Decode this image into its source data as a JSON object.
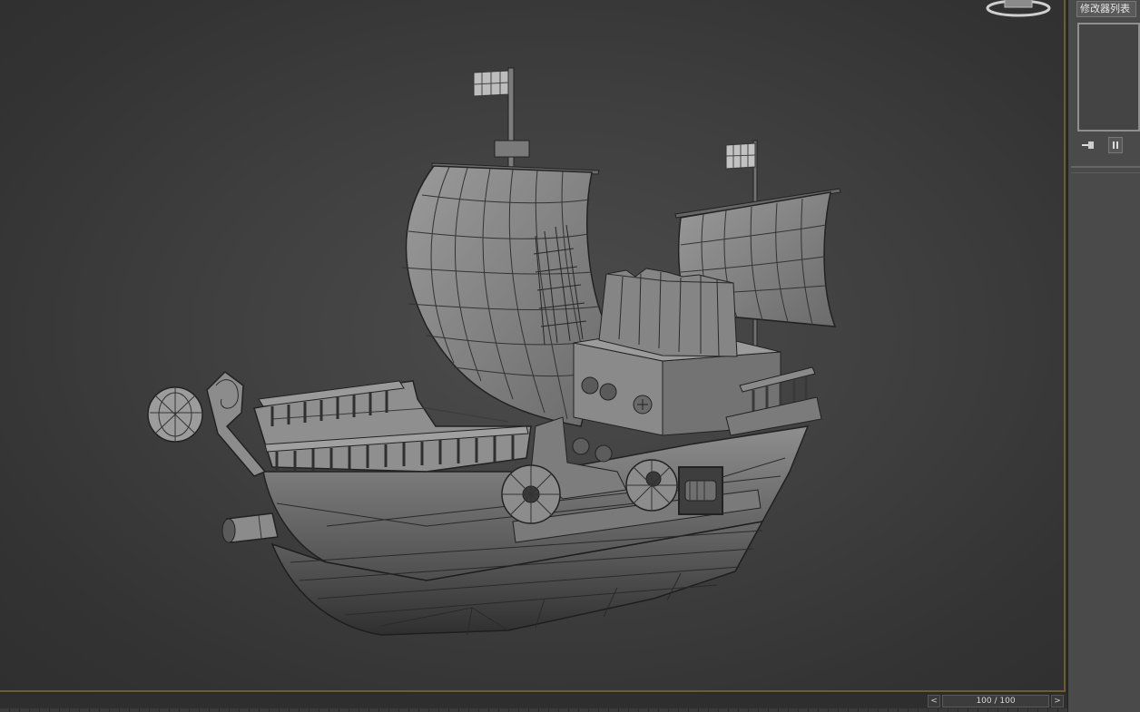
{
  "side_panel": {
    "modifier_list_label": "修改器列表",
    "pin_icon": "pin-stack-icon",
    "pause_icon": "pause-icon"
  },
  "time_slider": {
    "prev_glyph": "<",
    "next_glyph": ">",
    "frame_text": "100 / 100",
    "current_frame": 100,
    "total_frames": 100
  },
  "colors": {
    "viewport_bg": "#3f3f3f",
    "panel_bg": "#4a4a4a",
    "viewport_border_active": "#6e5d2c",
    "model_shade": "#8a8a8a",
    "wire": "#222222"
  },
  "viewport": {
    "object_icon": "pirate-ship-model"
  }
}
